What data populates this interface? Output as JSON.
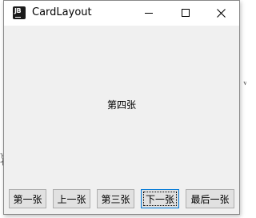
{
  "window": {
    "title": "CardLayout",
    "app_icon_text": "JB"
  },
  "card": {
    "current_label": "第四张"
  },
  "buttons": {
    "first": "第一张",
    "previous": "上一张",
    "third": "第三张",
    "next": "下一张",
    "last": "最后一张"
  },
  "background_fragments": {
    "left": "它 七",
    "right": "√"
  }
}
